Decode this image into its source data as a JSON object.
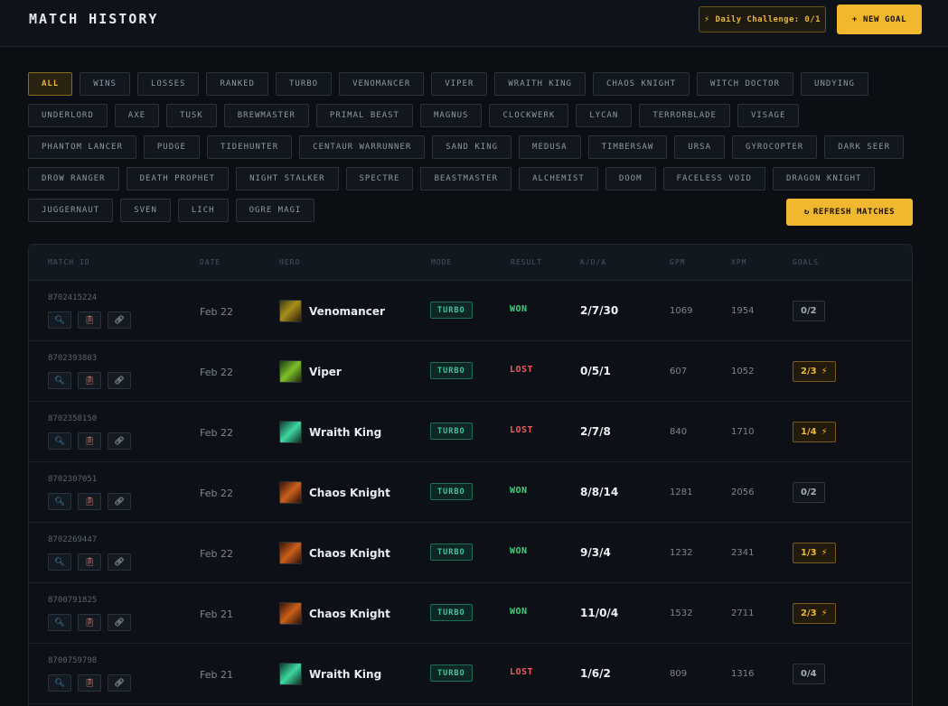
{
  "header": {
    "title": "MATCH HISTORY",
    "challenge_label": "Daily Challenge: 0/1",
    "new_goal_label": "+ NEW GOAL"
  },
  "filters": {
    "rows": [
      [
        "ALL",
        "WINS",
        "LOSSES",
        "RANKED",
        "TURBO",
        "VENOMANCER",
        "VIPER",
        "WRAITH KING",
        "CHAOS KNIGHT",
        "WITCH DOCTOR",
        "UNDYING"
      ],
      [
        "UNDERLORD",
        "AXE",
        "TUSK",
        "BREWMASTER",
        "PRIMAL BEAST",
        "MAGNUS",
        "CLOCKWERK",
        "LYCAN",
        "TERRORBLADE",
        "VISAGE"
      ],
      [
        "PHANTOM LANCER",
        "PUDGE",
        "TIDEHUNTER",
        "CENTAUR WARRUNNER",
        "SAND KING",
        "MEDUSA",
        "TIMBERSAW",
        "URSA",
        "GYROCOPTER",
        "DARK SEER"
      ],
      [
        "DROW RANGER",
        "DEATH PROPHET",
        "NIGHT STALKER",
        "SPECTRE",
        "BEASTMASTER",
        "ALCHEMIST",
        "DOOM",
        "FACELESS VOID",
        "DRAGON KNIGHT"
      ],
      [
        "JUGGERNAUT",
        "SVEN",
        "LICH",
        "OGRE MAGI"
      ]
    ],
    "active": "ALL",
    "refresh_label": "REFRESH MATCHES"
  },
  "table": {
    "headers": [
      "MATCH ID",
      "DATE",
      "HERO",
      "MODE",
      "RESULT",
      "K/D/A",
      "GPM",
      "XPM",
      "GOALS"
    ],
    "rows": [
      {
        "id": "8702415224",
        "date": "Feb 22",
        "hero": "Venomancer",
        "portrait": "venomancer",
        "mode": "TURBO",
        "result": "WON",
        "kda": "2/7/30",
        "gpm": "1069",
        "xpm": "1954",
        "goals": "0/2",
        "bolt": false
      },
      {
        "id": "8702393803",
        "date": "Feb 22",
        "hero": "Viper",
        "portrait": "viper",
        "mode": "TURBO",
        "result": "LOST",
        "kda": "0/5/1",
        "gpm": "607",
        "xpm": "1052",
        "goals": "2/3",
        "bolt": true
      },
      {
        "id": "8702358150",
        "date": "Feb 22",
        "hero": "Wraith King",
        "portrait": "wraith",
        "mode": "TURBO",
        "result": "LOST",
        "kda": "2/7/8",
        "gpm": "840",
        "xpm": "1710",
        "goals": "1/4",
        "bolt": true
      },
      {
        "id": "8702307051",
        "date": "Feb 22",
        "hero": "Chaos Knight",
        "portrait": "chaos",
        "mode": "TURBO",
        "result": "WON",
        "kda": "8/8/14",
        "gpm": "1281",
        "xpm": "2056",
        "goals": "0/2",
        "bolt": false
      },
      {
        "id": "8702269447",
        "date": "Feb 22",
        "hero": "Chaos Knight",
        "portrait": "chaos",
        "mode": "TURBO",
        "result": "WON",
        "kda": "9/3/4",
        "gpm": "1232",
        "xpm": "2341",
        "goals": "1/3",
        "bolt": true
      },
      {
        "id": "8700791825",
        "date": "Feb 21",
        "hero": "Chaos Knight",
        "portrait": "chaos",
        "mode": "TURBO",
        "result": "WON",
        "kda": "11/0/4",
        "gpm": "1532",
        "xpm": "2711",
        "goals": "2/3",
        "bolt": true
      },
      {
        "id": "8700759798",
        "date": "Feb 21",
        "hero": "Wraith King",
        "portrait": "wraith",
        "mode": "TURBO",
        "result": "LOST",
        "kda": "1/6/2",
        "gpm": "809",
        "xpm": "1316",
        "goals": "0/4",
        "bolt": false
      }
    ]
  },
  "icons": {
    "bolt": "lightning-icon",
    "refresh": "refresh-icon",
    "search": "search-icon",
    "notes": "notes-icon",
    "link": "link-icon"
  },
  "colors": {
    "accent": "#f0b72f",
    "won": "#3ed27a",
    "lost": "#ef5a5a",
    "turbo": "#3fc6a8"
  }
}
